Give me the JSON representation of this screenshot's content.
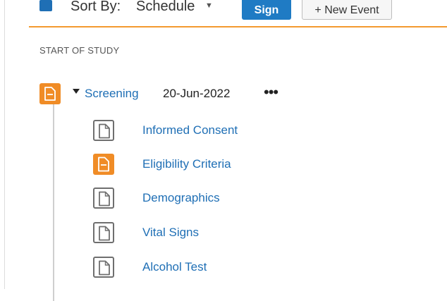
{
  "toolbar": {
    "sort_label": "Sort By:",
    "sort_value": "Schedule",
    "sign_button": "Sign",
    "new_event_button": "+ New Event"
  },
  "section_label": "START OF STUDY",
  "event": {
    "name": "Screening",
    "date": "20-Jun-2022",
    "menu_glyph": "•••"
  },
  "forms": [
    {
      "label": "Informed Consent",
      "status": "not-started"
    },
    {
      "label": "Eligibility Criteria",
      "status": "in-progress"
    },
    {
      "label": "Demographics",
      "status": "not-started"
    },
    {
      "label": "Vital Signs",
      "status": "not-started"
    },
    {
      "label": "Alcohol Test",
      "status": "not-started"
    }
  ],
  "colors": {
    "accent_orange": "#f08c26",
    "link_blue": "#1f6fb5",
    "primary_button": "#1f7bc4",
    "icon_grey": "#6f6f6f"
  }
}
